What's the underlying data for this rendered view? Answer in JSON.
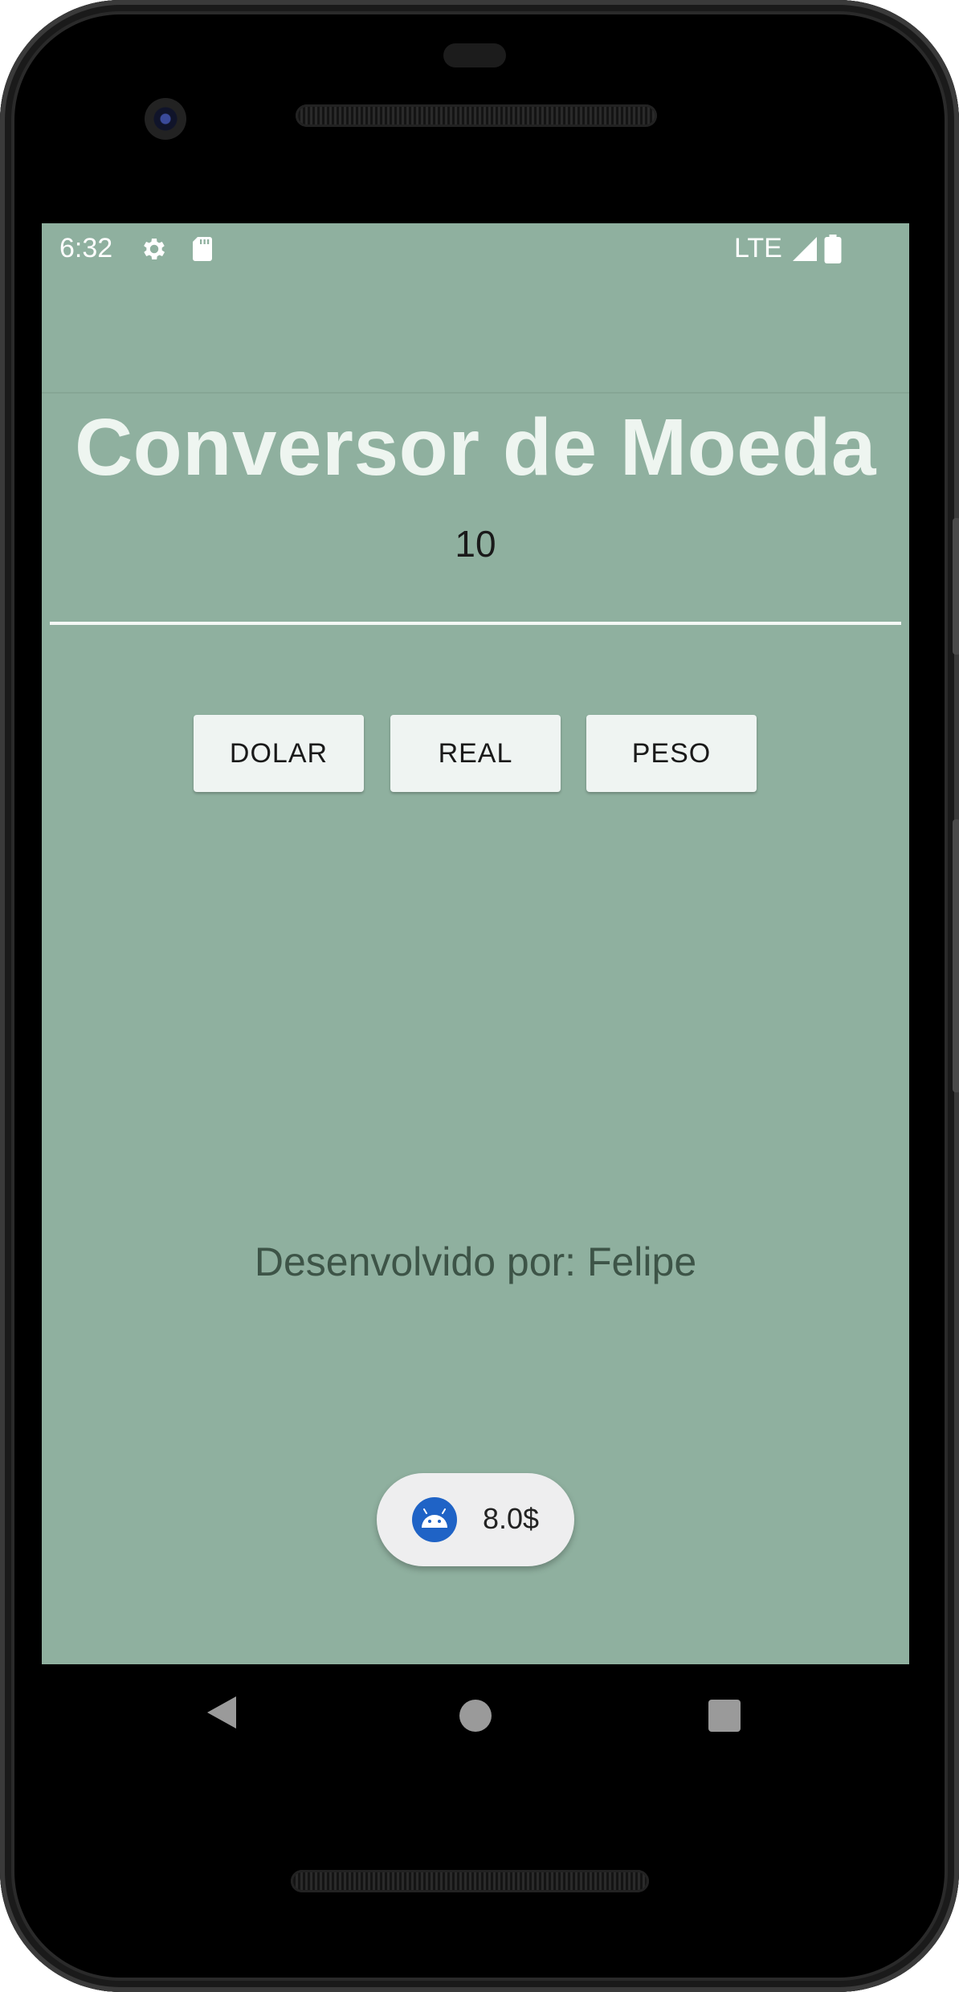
{
  "status_bar": {
    "time": "6:32",
    "network": "LTE",
    "icons": [
      "settings-icon",
      "sd-card-icon",
      "signal-icon",
      "battery-icon"
    ]
  },
  "app": {
    "title": "Conversor de Moeda",
    "amount_value": "10",
    "buttons": {
      "dolar": "DOLAR",
      "real": "REAL",
      "peso": "PESO"
    },
    "credit": "Desenvolvido por: Felipe"
  },
  "toast": {
    "text": "8.0$",
    "icon": "android-icon"
  },
  "navigation": {
    "buttons": [
      "back-icon",
      "home-icon",
      "recents-icon"
    ]
  },
  "colors": {
    "background": "#8fb09f",
    "title": "#eef5f0",
    "button": "#eff4f2",
    "toast_icon": "#1f63c6"
  }
}
